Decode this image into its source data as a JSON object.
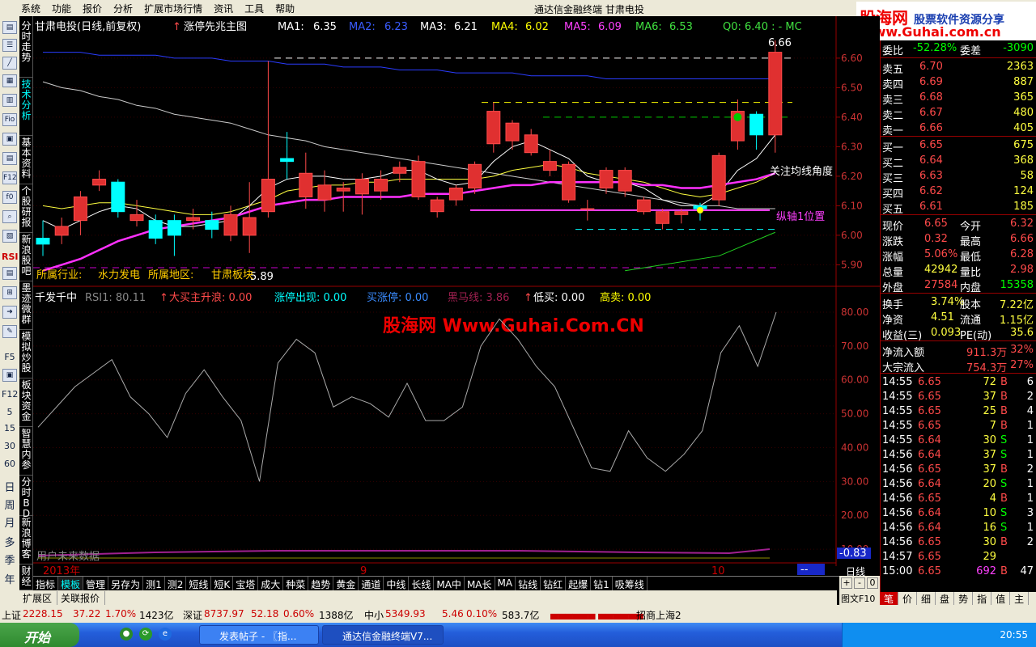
{
  "menu": [
    "系统",
    "功能",
    "报价",
    "分析",
    "扩展市场行情",
    "资讯",
    "工具",
    "帮助"
  ],
  "window_title": "通达信金融终端   甘肃电投",
  "logo": {
    "text1": "股海网",
    "text2": "股票软件资源分享",
    "text3": "Www.Guhai.com.cn"
  },
  "left_tabs": [
    "分时走势",
    "技术分析",
    "基本资料",
    "个股研报",
    "新浪股吧",
    "墨迹微群",
    "模拟炒股",
    "板块资金",
    "智慧内参",
    "分时BD",
    "新浪博客",
    "财经"
  ],
  "left_icons": [
    "RSI",
    "F5",
    "F12",
    "5",
    "15",
    "30",
    "60",
    "日",
    "周",
    "月",
    "多",
    "季",
    "年"
  ],
  "header": {
    "stock": "甘肃电投(日线,前复权)",
    "indicator": "涨停先兆主图",
    "ma1_label": "MA1:",
    "ma1": "6.35",
    "ma2_label": "MA2:",
    "ma2": "6.23",
    "ma3_label": "MA3:",
    "ma3": "6.21",
    "ma4_label": "MA4:",
    "ma4": "6.02",
    "ma5_label": "MA5:",
    "ma5": "6.09",
    "ma6_label": "MA6:",
    "ma6": "6.53",
    "q0": "Q0: 6.40 : - MC"
  },
  "price_axis": [
    "6.60",
    "6.50",
    "6.40",
    "6.30",
    "6.20",
    "6.10",
    "6.00",
    "5.90"
  ],
  "annotations": {
    "max": "6.66",
    "min": "5.89",
    "angle": "关注均线角度",
    "axis1": "纵轴1位置",
    "industry": "所属行业:",
    "industry_v": "水力发电",
    "region": "所属地区:",
    "region_v": "甘肃板块"
  },
  "sub": {
    "name": "千发千中",
    "rsi": "RSI1: 80.11",
    "f1": "大买主升浪: 0.00",
    "f2": "涨停出现: 0.00",
    "f3": "买涨停: 0.00",
    "f4": "黑马线: 3.86",
    "f5": "低买: 0.00",
    "f6": "高卖: 0.00",
    "watermark": "股海网 Www.Guhai.Com.CN",
    "nofuture": "用户未来数据",
    "readout": "-0.83"
  },
  "rsi_axis": [
    "80.00",
    "70.00",
    "60.00",
    "50.00",
    "40.00",
    "30.00",
    "20.00",
    "10.00"
  ],
  "dates": [
    "2013年",
    "9",
    "10"
  ],
  "bottom_tabs": [
    "指标",
    "模板",
    "管理",
    "另存为",
    "测1",
    "测2",
    "短线",
    "短K",
    "宝塔",
    "成大",
    "种菜",
    "趋势",
    "黄金",
    "通道",
    "中线",
    "长线",
    "MA中",
    "MA长",
    "MA",
    "钻线",
    "钻红",
    "起爆",
    "钻1",
    "吸筹线"
  ],
  "period": "日线",
  "right_small": [
    "+",
    "-",
    "0",
    "图文F10"
  ],
  "ext_tabs": [
    "扩展区",
    "关联报价"
  ],
  "quote": {
    "wb_label": "委比",
    "wb": "-52.28%",
    "wc_label": "委差",
    "wc": "-3090",
    "sell": [
      [
        "卖五",
        "6.70",
        "2363"
      ],
      [
        "卖四",
        "6.69",
        "887"
      ],
      [
        "卖三",
        "6.68",
        "365"
      ],
      [
        "卖二",
        "6.67",
        "480"
      ],
      [
        "卖一",
        "6.66",
        "405"
      ]
    ],
    "buy": [
      [
        "买一",
        "6.65",
        "675"
      ],
      [
        "买二",
        "6.64",
        "368"
      ],
      [
        "买三",
        "6.63",
        "58"
      ],
      [
        "买四",
        "6.62",
        "124"
      ],
      [
        "买五",
        "6.61",
        "185"
      ]
    ],
    "stats": [
      [
        "现价",
        "6.65",
        "今开",
        "6.32"
      ],
      [
        "涨跌",
        "0.32",
        "最高",
        "6.66"
      ],
      [
        "涨幅",
        "5.06%",
        "最低",
        "6.28"
      ],
      [
        "总量",
        "42942",
        "量比",
        "2.98"
      ],
      [
        "外盘",
        "27584",
        "内盘",
        "15358"
      ]
    ],
    "fin": [
      [
        "换手",
        "3.74%",
        "股本",
        "7.22亿"
      ],
      [
        "净资",
        "4.51",
        "流通",
        "1.15亿"
      ],
      [
        "收益(三)",
        "0.093",
        "PE(动)",
        "35.6"
      ]
    ],
    "flow": [
      [
        "净流入额",
        "911.3万",
        "32%"
      ],
      [
        "大宗流入",
        "754.3万",
        "27%"
      ]
    ],
    "ticks": [
      [
        "14:55",
        "6.65",
        "72",
        "B",
        "6"
      ],
      [
        "14:55",
        "6.65",
        "37",
        "B",
        "2"
      ],
      [
        "14:55",
        "6.65",
        "25",
        "B",
        "4"
      ],
      [
        "14:55",
        "6.65",
        "7",
        "B",
        "1"
      ],
      [
        "14:55",
        "6.64",
        "30",
        "S",
        "1"
      ],
      [
        "14:56",
        "6.64",
        "37",
        "S",
        "1"
      ],
      [
        "14:56",
        "6.65",
        "37",
        "B",
        "2"
      ],
      [
        "14:56",
        "6.64",
        "20",
        "S",
        "1"
      ],
      [
        "14:56",
        "6.65",
        "4",
        "B",
        "1"
      ],
      [
        "14:56",
        "6.64",
        "10",
        "S",
        "3"
      ],
      [
        "14:56",
        "6.64",
        "16",
        "S",
        "1"
      ],
      [
        "14:56",
        "6.65",
        "30",
        "B",
        "2"
      ],
      [
        "14:57",
        "6.65",
        "29",
        "",
        ""
      ],
      [
        "15:00",
        "6.65",
        "692",
        "B",
        "47"
      ]
    ]
  },
  "rp_tabs": [
    "笔",
    "价",
    "细",
    "盘",
    "势",
    "指",
    "值",
    "主"
  ],
  "status": {
    "sh": "上证",
    "sh_v": "2228.15",
    "sh_c": "37.22",
    "sh_p": "1.70%",
    "sh_a": "1423亿",
    "sz": "深证",
    "sz_v": "8737.97",
    "sz_c": "52.18",
    "sz_p": "0.60%",
    "sz_a": "1388亿",
    "zx": "中小",
    "zx_v": "5349.93",
    "zx_c": "5.46",
    "zx_p": "0.10%",
    "zx_a": "583.7亿",
    "broker": "招商上海2"
  },
  "taskbar": {
    "start": "开始",
    "t1": "发表帖子 - 〖指...",
    "t2": "通达信金融终端V7...",
    "clock": "20:55"
  },
  "colors": {
    "up": "#ff4a4a",
    "down": "#00ffff",
    "bg": "#000000"
  },
  "chart_data": {
    "type": "candlestick",
    "ylim": [
      5.86,
      6.66
    ],
    "candles": [
      [
        5.99,
        5.97,
        6.05,
        5.93
      ],
      [
        6.0,
        6.03,
        6.06,
        5.97
      ],
      [
        6.05,
        6.13,
        6.15,
        6.0
      ],
      [
        6.17,
        6.19,
        6.22,
        6.15
      ],
      [
        6.18,
        6.08,
        6.19,
        6.06
      ],
      [
        6.05,
        6.07,
        6.12,
        6.03
      ],
      [
        6.05,
        5.99,
        6.07,
        5.97
      ],
      [
        6.05,
        6.0,
        6.07,
        5.93
      ],
      [
        6.05,
        6.06,
        6.09,
        6.02
      ],
      [
        6.05,
        6.02,
        6.08,
        5.99
      ],
      [
        6.0,
        6.07,
        6.1,
        5.98
      ],
      [
        6.0,
        6.06,
        6.18,
        5.94
      ],
      [
        6.08,
        6.19,
        6.59,
        6.06
      ],
      [
        6.26,
        6.25,
        6.35,
        6.19
      ],
      [
        6.13,
        6.21,
        6.28,
        6.09
      ],
      [
        6.12,
        6.17,
        6.22,
        6.08
      ],
      [
        6.15,
        6.16,
        6.18,
        6.08
      ],
      [
        6.14,
        6.19,
        6.21,
        6.07
      ],
      [
        6.15,
        6.19,
        6.22,
        6.12
      ],
      [
        6.21,
        6.23,
        6.25,
        6.18
      ],
      [
        6.13,
        6.25,
        6.27,
        6.12
      ],
      [
        6.08,
        6.12,
        6.13,
        6.06
      ],
      [
        6.12,
        6.16,
        6.17,
        6.1
      ],
      [
        6.16,
        6.24,
        6.25,
        6.14
      ],
      [
        6.31,
        6.42,
        6.45,
        6.28
      ],
      [
        6.32,
        6.38,
        6.39,
        6.29
      ],
      [
        6.28,
        6.34,
        6.36,
        6.27
      ],
      [
        6.22,
        6.25,
        6.29,
        6.2
      ],
      [
        6.12,
        6.24,
        6.25,
        6.11
      ],
      [
        6.09,
        6.09,
        6.12,
        6.05
      ],
      [
        6.16,
        6.22,
        6.23,
        6.14
      ],
      [
        6.15,
        6.22,
        6.23,
        6.13
      ],
      [
        6.08,
        6.12,
        6.13,
        6.07
      ],
      [
        6.04,
        6.08,
        6.09,
        6.02
      ],
      [
        6.07,
        6.08,
        6.09,
        6.04
      ],
      [
        6.1,
        6.09,
        6.11,
        6.05
      ],
      [
        6.12,
        6.27,
        6.28,
        6.1
      ],
      [
        6.32,
        6.42,
        6.46,
        6.29
      ],
      [
        6.41,
        6.34,
        6.42,
        6.29
      ],
      [
        6.34,
        6.62,
        6.66,
        6.28
      ]
    ],
    "ma_fast": [
      6.05,
      6.02,
      6.05,
      6.08,
      6.1,
      6.09,
      6.05,
      6.03,
      6.03,
      6.04,
      6.05,
      6.1,
      6.16,
      6.19,
      6.2,
      6.2,
      6.19,
      6.19,
      6.2,
      6.22,
      6.22,
      6.19,
      6.17,
      6.18,
      6.25,
      6.3,
      6.32,
      6.29,
      6.26,
      6.2,
      6.18,
      6.18,
      6.16,
      6.12,
      6.1,
      6.1,
      6.14,
      6.22,
      6.26,
      6.34
    ],
    "ma_mid": [
      6.1,
      6.09,
      6.1,
      6.11,
      6.11,
      6.1,
      6.09,
      6.08,
      6.07,
      6.07,
      6.08,
      6.1,
      6.12,
      6.15,
      6.16,
      6.17,
      6.17,
      6.18,
      6.18,
      6.19,
      6.19,
      6.19,
      6.19,
      6.19,
      6.2,
      6.22,
      6.23,
      6.24,
      6.23,
      6.21,
      6.2,
      6.19,
      6.18,
      6.16,
      6.14,
      6.13,
      6.14,
      6.16,
      6.18,
      6.21
    ],
    "ma_pink": [
      5.88,
      5.9,
      5.92,
      5.95,
      5.98,
      6.0,
      6.02,
      6.03,
      6.04,
      6.05,
      6.06,
      6.08,
      6.1,
      6.11,
      6.12,
      6.12,
      6.13,
      6.13,
      6.13,
      6.13,
      6.14,
      6.14,
      6.14,
      6.15,
      6.16,
      6.17,
      6.17,
      6.18,
      6.18,
      6.18,
      6.18,
      6.18,
      6.17,
      6.17,
      6.16,
      6.16,
      6.17,
      6.18,
      6.19,
      6.21
    ],
    "ma_white": [
      6.52,
      6.5,
      6.49,
      6.47,
      6.46,
      6.44,
      6.43,
      6.41,
      6.4,
      6.39,
      6.38,
      6.36,
      6.34,
      6.33,
      6.32,
      6.3,
      6.29,
      6.28,
      6.27,
      6.26,
      6.25,
      6.24,
      6.23,
      6.22,
      6.21,
      6.2,
      6.19,
      6.18,
      6.17,
      6.16,
      6.15,
      6.14,
      6.13,
      6.12,
      6.11,
      6.1,
      6.1,
      6.09,
      6.09,
      6.09
    ],
    "ma_blue": [
      6.62,
      6.62,
      6.62,
      6.61,
      6.61,
      6.61,
      6.61,
      6.6,
      6.6,
      6.6,
      6.59,
      6.59,
      6.59,
      6.58,
      6.58,
      6.58,
      6.57,
      6.57,
      6.57,
      6.56,
      6.56,
      6.56,
      6.55,
      6.55,
      6.55,
      6.55,
      6.54,
      6.54,
      6.54,
      6.54,
      6.53,
      6.53,
      6.53,
      6.53,
      6.53,
      6.53,
      6.53,
      6.53,
      6.53,
      6.53
    ],
    "rsi": [
      46,
      52,
      58,
      62,
      66,
      55,
      50,
      43,
      56,
      63,
      55,
      48,
      30,
      65,
      72,
      68,
      52,
      55,
      53,
      49,
      59,
      48,
      48,
      52,
      70,
      78,
      72,
      64,
      58,
      46,
      34,
      33,
      45,
      37,
      33,
      38,
      45,
      68,
      76,
      64,
      80
    ]
  }
}
